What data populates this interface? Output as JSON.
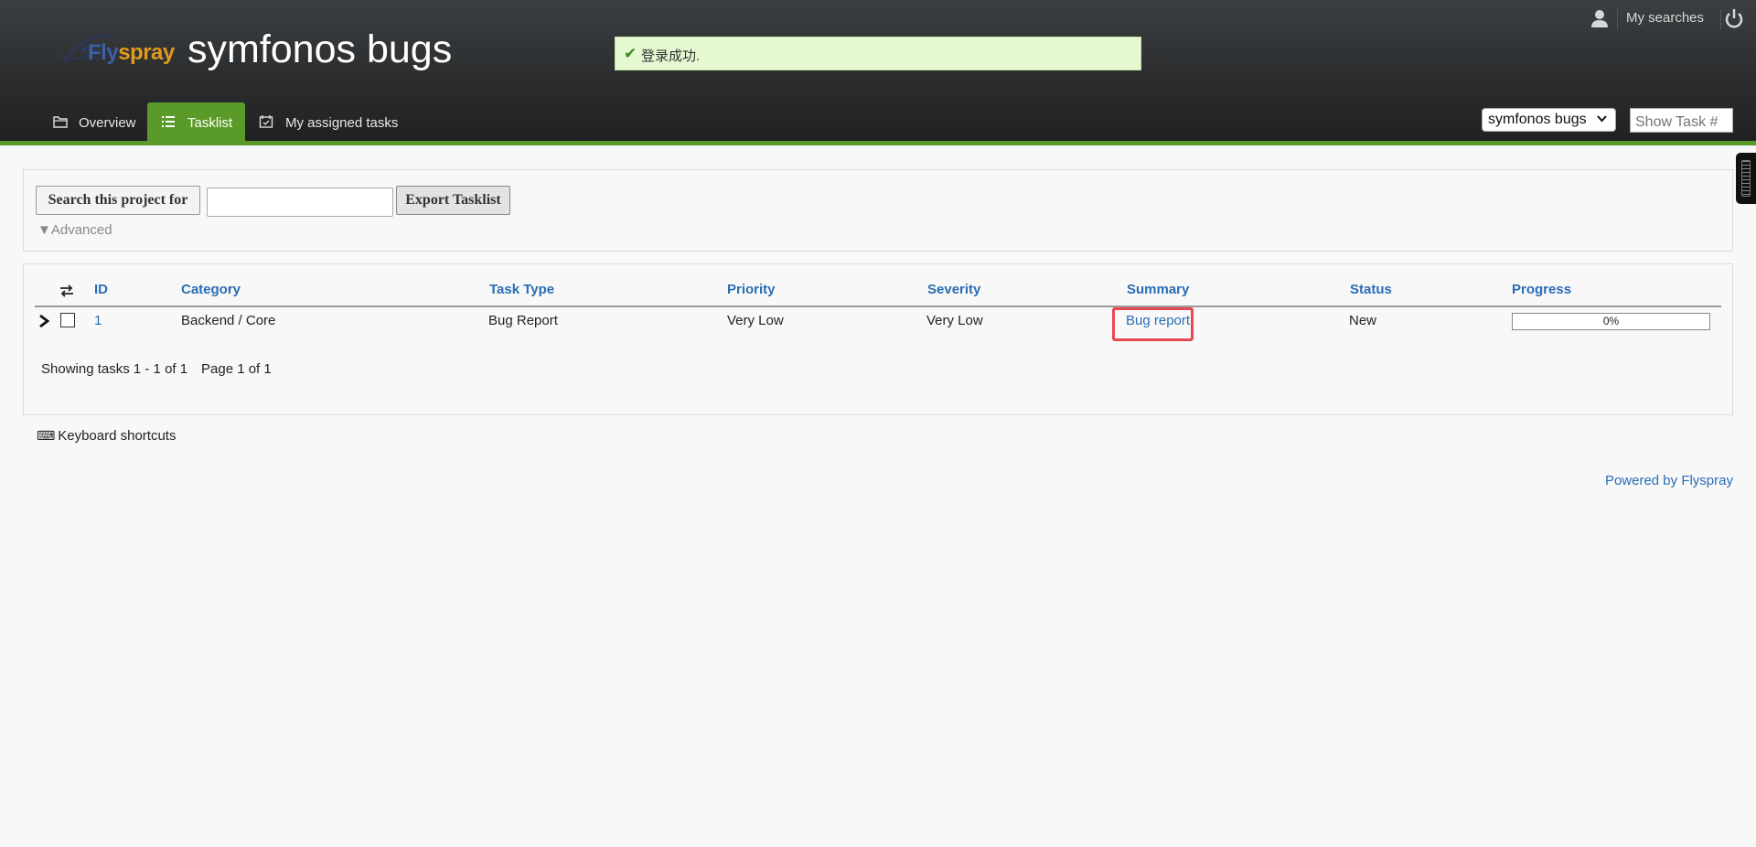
{
  "header": {
    "logo": {
      "fly": "Fly",
      "spray": "spray"
    },
    "project_title": "symfonos bugs",
    "success_message": "登录成功.",
    "my_searches": "My searches",
    "project_select": "symfonos bugs",
    "show_task_placeholder": "Show Task #"
  },
  "nav": {
    "tabs": [
      {
        "label": "Overview"
      },
      {
        "label": "Tasklist"
      },
      {
        "label": "My assigned tasks"
      }
    ]
  },
  "search": {
    "label_button": "Search this project for",
    "input_value": "",
    "export_button": "Export Tasklist",
    "advanced": "▼Advanced"
  },
  "table": {
    "columns": [
      "ID",
      "Category",
      "Task Type",
      "Priority",
      "Severity",
      "Summary",
      "Status",
      "Progress"
    ],
    "rows": [
      {
        "id": "1",
        "category": "Backend / Core",
        "task_type": "Bug Report",
        "priority": "Very Low",
        "severity": "Very Low",
        "summary": "Bug report",
        "status": "New",
        "progress": "0%",
        "progress_value": 0
      }
    ],
    "showing": "Showing tasks 1 - 1 of 1",
    "page": "Page 1 of 1"
  },
  "footer": {
    "keyboard_shortcuts": "Keyboard shortcuts",
    "powered_by": "Powered by Flyspray"
  },
  "colors": {
    "accent_green": "#5a9a28",
    "link_blue": "#2a6db5",
    "highlight_red": "#e8494f"
  }
}
